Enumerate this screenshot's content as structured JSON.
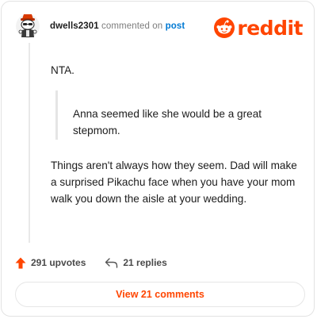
{
  "header": {
    "username": "dwells2301",
    "verb": "commented on",
    "post_link": "post",
    "logo_text": "reddit"
  },
  "comment": {
    "paragraph1": "NTA.",
    "quote_line1": "Anna seemed like she would be a great",
    "quote_line2": "stepmom.",
    "paragraph2": "Things aren't always how they seem. Dad will make a surprised Pikachu face when you have your mom walk you down the aisle at your wedding."
  },
  "actions": {
    "upvotes": "291 upvotes",
    "replies": "21 replies"
  },
  "view_comments": "View 21 comments",
  "colors": {
    "brand": "#ff4500",
    "link": "#0079d3",
    "text": "#1c1c1c"
  },
  "icons": [
    "snoo-avatar-icon",
    "reddit-logo-icon",
    "upvote-arrow-icon",
    "reply-arrow-icon"
  ]
}
